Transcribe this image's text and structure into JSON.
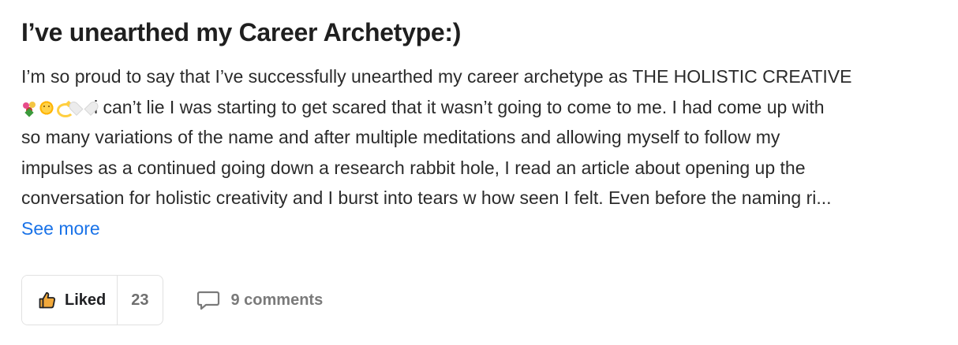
{
  "post": {
    "title": "I’ve unearthed my Career Archetype:)",
    "body_lines": [
      "I’m so proud to say that I’ve successfully unearthed my career archetype as THE HOLISTIC CREATIVE",
      "i can’t lie I was starting to get scared that it wasn’t going to come to me. I had come up with",
      "so many variations of the name and after multiple meditations and allowing myself to follow my",
      "impulses as a continued going down a research rabbit hole, I read an article about opening up the",
      "conversation for holistic creativity and I burst into tears w how seen I felt. Even before the naming ri..."
    ],
    "emojis": [
      "flowers-emoji",
      "sun-emoji",
      "dizzy-emoji",
      "white-heart-emoji"
    ],
    "see_more_label": "See more"
  },
  "actions": {
    "like_label": "Liked",
    "like_count": "23",
    "like_icon": "thumbs-up-icon",
    "comments_label": "9 comments",
    "comments_icon": "comment-bubble-icon"
  },
  "colors": {
    "link": "#1a73e8",
    "title": "#1f1f1f",
    "muted": "#7a7a7a",
    "border": "#e1e1e1"
  }
}
